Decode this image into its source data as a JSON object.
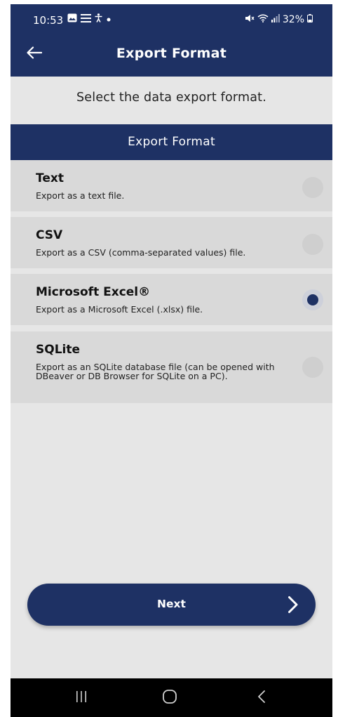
{
  "status_bar": {
    "time": "10:53",
    "battery": "32%",
    "left_icons": [
      "image-icon",
      "menu-icon",
      "accessibility-icon",
      "dot-icon"
    ],
    "right_icons": [
      "mute-icon",
      "wifi-icon",
      "signal-icon",
      "battery-icon"
    ]
  },
  "app_bar": {
    "title": "Export Format",
    "back_icon": "arrow-left-icon"
  },
  "instruction": "Select the data export format.",
  "section_header": "Export Format",
  "options": [
    {
      "title": "Text",
      "description": "Export as a text file.",
      "selected": false
    },
    {
      "title": "CSV",
      "description": "Export as a CSV (comma-separated values)  file.",
      "selected": false
    },
    {
      "title": "Microsoft Excel®",
      "description": "Export as a Microsoft Excel (.xlsx) file.",
      "selected": true
    },
    {
      "title": "SQLite",
      "description": "Export as an SQLite database file (can be opened with DBeaver or DB Browser for SQLite on a PC).",
      "selected": false
    }
  ],
  "next_button": {
    "label": "Next",
    "icon": "chevron-right-icon"
  },
  "nav_bar": {
    "recents_icon": "recents-icon",
    "home_icon": "home-icon",
    "back_icon": "nav-back-icon"
  },
  "colors": {
    "primary": "#1e3164",
    "background": "#e6e6e6",
    "option_background": "#d9d9d9"
  }
}
